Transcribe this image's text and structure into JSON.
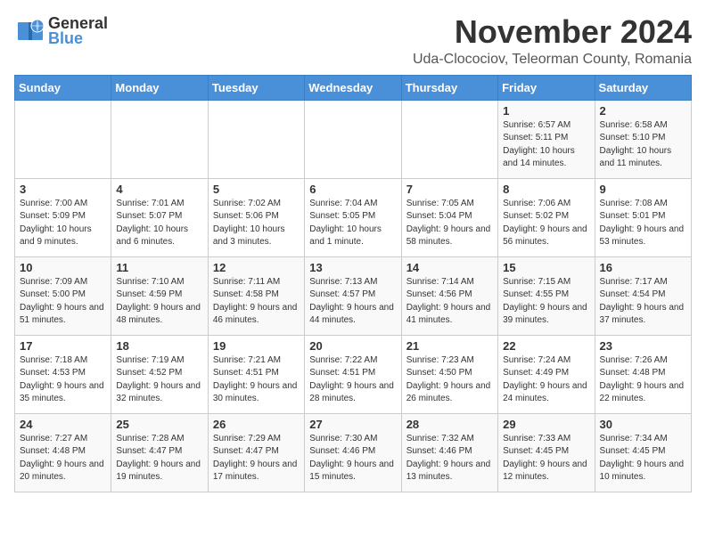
{
  "logo": {
    "general": "General",
    "blue": "Blue"
  },
  "header": {
    "month": "November 2024",
    "location": "Uda-Clocociov, Teleorman County, Romania"
  },
  "weekdays": [
    "Sunday",
    "Monday",
    "Tuesday",
    "Wednesday",
    "Thursday",
    "Friday",
    "Saturday"
  ],
  "weeks": [
    [
      {
        "day": "",
        "info": ""
      },
      {
        "day": "",
        "info": ""
      },
      {
        "day": "",
        "info": ""
      },
      {
        "day": "",
        "info": ""
      },
      {
        "day": "",
        "info": ""
      },
      {
        "day": "1",
        "info": "Sunrise: 6:57 AM\nSunset: 5:11 PM\nDaylight: 10 hours and 14 minutes."
      },
      {
        "day": "2",
        "info": "Sunrise: 6:58 AM\nSunset: 5:10 PM\nDaylight: 10 hours and 11 minutes."
      }
    ],
    [
      {
        "day": "3",
        "info": "Sunrise: 7:00 AM\nSunset: 5:09 PM\nDaylight: 10 hours and 9 minutes."
      },
      {
        "day": "4",
        "info": "Sunrise: 7:01 AM\nSunset: 5:07 PM\nDaylight: 10 hours and 6 minutes."
      },
      {
        "day": "5",
        "info": "Sunrise: 7:02 AM\nSunset: 5:06 PM\nDaylight: 10 hours and 3 minutes."
      },
      {
        "day": "6",
        "info": "Sunrise: 7:04 AM\nSunset: 5:05 PM\nDaylight: 10 hours and 1 minute."
      },
      {
        "day": "7",
        "info": "Sunrise: 7:05 AM\nSunset: 5:04 PM\nDaylight: 9 hours and 58 minutes."
      },
      {
        "day": "8",
        "info": "Sunrise: 7:06 AM\nSunset: 5:02 PM\nDaylight: 9 hours and 56 minutes."
      },
      {
        "day": "9",
        "info": "Sunrise: 7:08 AM\nSunset: 5:01 PM\nDaylight: 9 hours and 53 minutes."
      }
    ],
    [
      {
        "day": "10",
        "info": "Sunrise: 7:09 AM\nSunset: 5:00 PM\nDaylight: 9 hours and 51 minutes."
      },
      {
        "day": "11",
        "info": "Sunrise: 7:10 AM\nSunset: 4:59 PM\nDaylight: 9 hours and 48 minutes."
      },
      {
        "day": "12",
        "info": "Sunrise: 7:11 AM\nSunset: 4:58 PM\nDaylight: 9 hours and 46 minutes."
      },
      {
        "day": "13",
        "info": "Sunrise: 7:13 AM\nSunset: 4:57 PM\nDaylight: 9 hours and 44 minutes."
      },
      {
        "day": "14",
        "info": "Sunrise: 7:14 AM\nSunset: 4:56 PM\nDaylight: 9 hours and 41 minutes."
      },
      {
        "day": "15",
        "info": "Sunrise: 7:15 AM\nSunset: 4:55 PM\nDaylight: 9 hours and 39 minutes."
      },
      {
        "day": "16",
        "info": "Sunrise: 7:17 AM\nSunset: 4:54 PM\nDaylight: 9 hours and 37 minutes."
      }
    ],
    [
      {
        "day": "17",
        "info": "Sunrise: 7:18 AM\nSunset: 4:53 PM\nDaylight: 9 hours and 35 minutes."
      },
      {
        "day": "18",
        "info": "Sunrise: 7:19 AM\nSunset: 4:52 PM\nDaylight: 9 hours and 32 minutes."
      },
      {
        "day": "19",
        "info": "Sunrise: 7:21 AM\nSunset: 4:51 PM\nDaylight: 9 hours and 30 minutes."
      },
      {
        "day": "20",
        "info": "Sunrise: 7:22 AM\nSunset: 4:51 PM\nDaylight: 9 hours and 28 minutes."
      },
      {
        "day": "21",
        "info": "Sunrise: 7:23 AM\nSunset: 4:50 PM\nDaylight: 9 hours and 26 minutes."
      },
      {
        "day": "22",
        "info": "Sunrise: 7:24 AM\nSunset: 4:49 PM\nDaylight: 9 hours and 24 minutes."
      },
      {
        "day": "23",
        "info": "Sunrise: 7:26 AM\nSunset: 4:48 PM\nDaylight: 9 hours and 22 minutes."
      }
    ],
    [
      {
        "day": "24",
        "info": "Sunrise: 7:27 AM\nSunset: 4:48 PM\nDaylight: 9 hours and 20 minutes."
      },
      {
        "day": "25",
        "info": "Sunrise: 7:28 AM\nSunset: 4:47 PM\nDaylight: 9 hours and 19 minutes."
      },
      {
        "day": "26",
        "info": "Sunrise: 7:29 AM\nSunset: 4:47 PM\nDaylight: 9 hours and 17 minutes."
      },
      {
        "day": "27",
        "info": "Sunrise: 7:30 AM\nSunset: 4:46 PM\nDaylight: 9 hours and 15 minutes."
      },
      {
        "day": "28",
        "info": "Sunrise: 7:32 AM\nSunset: 4:46 PM\nDaylight: 9 hours and 13 minutes."
      },
      {
        "day": "29",
        "info": "Sunrise: 7:33 AM\nSunset: 4:45 PM\nDaylight: 9 hours and 12 minutes."
      },
      {
        "day": "30",
        "info": "Sunrise: 7:34 AM\nSunset: 4:45 PM\nDaylight: 9 hours and 10 minutes."
      }
    ]
  ]
}
